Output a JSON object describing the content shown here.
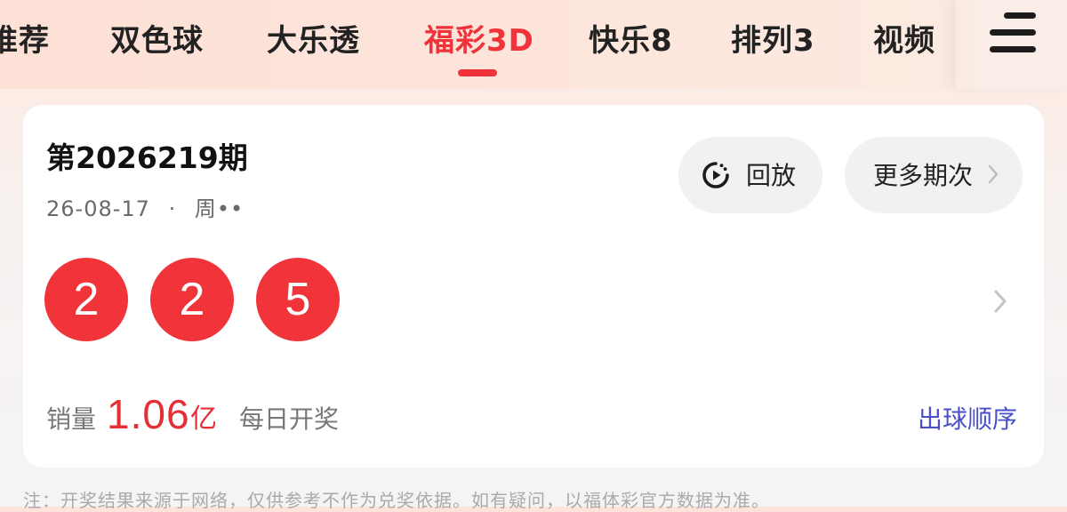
{
  "tabs": [
    {
      "label": "推荐"
    },
    {
      "label": "双色球"
    },
    {
      "label": "大乐透"
    },
    {
      "label": "福彩3D",
      "active": true
    },
    {
      "label": "快乐8"
    },
    {
      "label": "排列3"
    },
    {
      "label": "视频"
    }
  ],
  "menu_icon": "hamburger-menu-icon",
  "colors": {
    "accent": "#f0323a",
    "ball": "#f1333a",
    "link": "#4a4fc9"
  },
  "draw": {
    "period": "第2026219期",
    "date": "26-08-17",
    "separator": "·",
    "weekday": "周••",
    "replay_label": "回放",
    "replay_icon": "replay-icon",
    "more_label": "更多期次",
    "numbers": [
      "2",
      "2",
      "5"
    ],
    "sales_label": "销量",
    "sales_value": "1.06",
    "sales_unit": "亿",
    "frequency": "每日开奖",
    "order_link": "出球顺序"
  },
  "footnote": "注：开奖结果来源于网络，仅供参考不作为兑奖依据。如有疑问，以福体彩官方数据为准。"
}
